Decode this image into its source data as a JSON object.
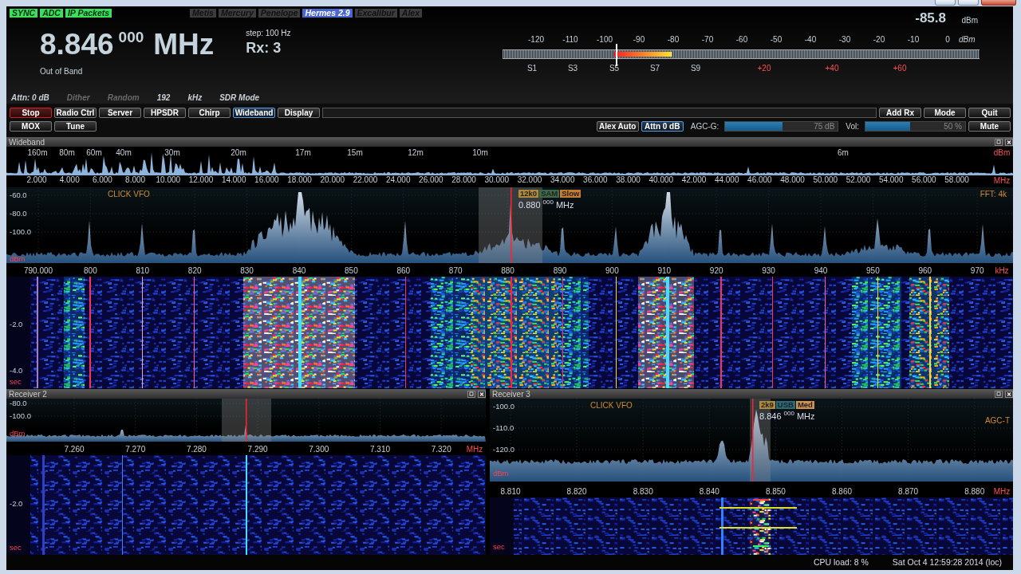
{
  "status_chips": [
    {
      "label": "SYNC",
      "on": true
    },
    {
      "label": "ADC",
      "on": true
    },
    {
      "label": "IP Packets",
      "on": true
    }
  ],
  "hardware_chips": [
    {
      "label": "Metis",
      "selected": false
    },
    {
      "label": "Mercury",
      "selected": false
    },
    {
      "label": "Penelope",
      "selected": false
    },
    {
      "label": "Hermes 2.9",
      "selected": true
    },
    {
      "label": "Excalibur",
      "selected": false
    },
    {
      "label": "Alex",
      "selected": false
    }
  ],
  "frequency": {
    "mhz": "8.846",
    "hz": "000",
    "unit": "MHz",
    "band": "Out of Band",
    "step": "step: 100 Hz",
    "receiver": "Rx: 3"
  },
  "info_row": [
    {
      "text": "Attn: 0 dB",
      "disabled": false
    },
    {
      "text": "Dither",
      "disabled": true
    },
    {
      "text": "Random",
      "disabled": true
    },
    {
      "text": "192",
      "disabled": false
    },
    {
      "text": "kHz",
      "disabled": false
    },
    {
      "text": "SDR Mode",
      "disabled": false
    }
  ],
  "meter": {
    "reading": "-85.8",
    "unit": "dBm",
    "scale": [
      "-120",
      "-110",
      "-100",
      "-90",
      "-80",
      "-70",
      "-60",
      "-50",
      "-40",
      "-30",
      "-20",
      "-10",
      "0"
    ],
    "scale_unit": "dBm",
    "s_units": [
      {
        "text": "S1",
        "over_s9": false
      },
      {
        "text": "S3",
        "over_s9": false
      },
      {
        "text": "S5",
        "over_s9": false
      },
      {
        "text": "S7",
        "over_s9": false
      },
      {
        "text": "S9",
        "over_s9": false
      },
      {
        "text": "+20",
        "over_s9": true
      },
      {
        "text": "+40",
        "over_s9": true
      },
      {
        "text": "+60",
        "over_s9": true
      }
    ],
    "level": 0.355,
    "peak": {
      "level": 0.237
    }
  },
  "toolbar": {
    "row1_left": [
      {
        "label": "Stop",
        "kind": "alert"
      },
      {
        "label": "Radio Ctrl",
        "kind": "normal"
      },
      {
        "label": "Server",
        "kind": "normal"
      },
      {
        "label": "HPSDR",
        "kind": "normal"
      },
      {
        "label": "Chirp",
        "kind": "normal"
      },
      {
        "label": "Wideband",
        "kind": "selected"
      },
      {
        "label": "Display",
        "kind": "normal"
      }
    ],
    "row1_right": [
      {
        "label": "Add Rx",
        "kind": "normal"
      },
      {
        "label": "Mode",
        "kind": "normal"
      },
      {
        "label": "Quit",
        "kind": "normal"
      }
    ],
    "row2_left": [
      {
        "label": "MOX",
        "kind": "normal"
      },
      {
        "label": "Tune",
        "kind": "normal"
      }
    ],
    "row2_right": [
      {
        "label": "Alex Auto",
        "kind": "normal"
      },
      {
        "label": "Attn 0 dB",
        "kind": "selected"
      }
    ],
    "agc": {
      "label": "AGC-G:",
      "reading": "75 dB",
      "level": 0.51
    },
    "volume": {
      "label": "Vol:",
      "reading": "50 %",
      "level": 0.45
    },
    "mute": {
      "label": "Mute",
      "kind": "normal"
    }
  },
  "wideband": {
    "title": "Wideband",
    "bands": [
      "160m",
      "80m",
      "60m",
      "40m",
      "30m",
      "20m",
      "17m",
      "15m",
      "12m",
      "10m",
      "6m"
    ],
    "x_ticks": [
      "2.000",
      "4.000",
      "6.000",
      "8.000",
      "10.000",
      "12.000",
      "14.000",
      "16.000",
      "18.000",
      "20.000",
      "22.000",
      "24.000",
      "26.000",
      "28.000",
      "30.000",
      "32.000",
      "34.000",
      "36.000",
      "38.000",
      "40.000",
      "42.000",
      "44.000",
      "46.000",
      "48.000",
      "50.000",
      "52.000",
      "54.000",
      "56.000",
      "58.000"
    ],
    "x_unit": "MHz",
    "y_unit": "dBm"
  },
  "main_receiver": {
    "y_labels": [
      "-60.0",
      "-80.0",
      "-100.0"
    ],
    "y_unit": "dBm",
    "vfo_hint": "CLICK VFO",
    "fft": "FFT: 4k",
    "filter_tags": [
      {
        "text": "12k0",
        "color": "#b08a3a"
      },
      {
        "text": "SAM",
        "color": "#3a6a4a"
      },
      {
        "text": "Slow",
        "color": "#c87a30"
      }
    ],
    "vfo_freq": {
      "main": "0.880",
      "sub": "000",
      "unit": "MHz"
    },
    "x_ticks": [
      "790.000",
      "800",
      "810",
      "820",
      "830",
      "840",
      "850",
      "860",
      "870",
      "880",
      "890",
      "900",
      "910",
      "920",
      "930",
      "940",
      "950",
      "960",
      "970"
    ],
    "x_unit": "kHz",
    "waterfall_labels": [
      "-2.0",
      "-4.0"
    ],
    "time_unit": "sec"
  },
  "receivers": [
    {
      "title": "Receiver 2",
      "y_labels": [
        "-80.0",
        "-100.0"
      ],
      "y_unit": "dBm",
      "x_ticks": [
        "7.260",
        "7.270",
        "7.280",
        "7.290",
        "7.300",
        "7.310",
        "7.320"
      ],
      "x_unit": "MHz",
      "waterfall_labels": [
        "-2.0"
      ],
      "time_unit": "sec"
    },
    {
      "title": "Receiver 3",
      "y_labels": [
        "-100.0",
        "-110.0",
        "-120.0"
      ],
      "y_unit": "dBm",
      "vfo_hint": "CLICK VFO",
      "agc_label": "AGC-T",
      "filter_tags": [
        {
          "text": "2k9",
          "color": "#b08a3a"
        },
        {
          "text": "USB",
          "color": "#2a6a7a"
        },
        {
          "text": "Med",
          "color": "#d09050"
        }
      ],
      "vfo_freq": {
        "main": "8.846",
        "sub": "000",
        "unit": "MHz"
      },
      "x_ticks": [
        "8.810",
        "8.820",
        "8.830",
        "8.840",
        "8.850",
        "8.860",
        "8.870",
        "8.880"
      ],
      "x_unit": "MHz",
      "time_unit": "sec"
    }
  ],
  "status_bar": {
    "cpu": "CPU load: 8 %",
    "clock": "Sat Oct 4 12:59:28 2014 (loc)"
  }
}
